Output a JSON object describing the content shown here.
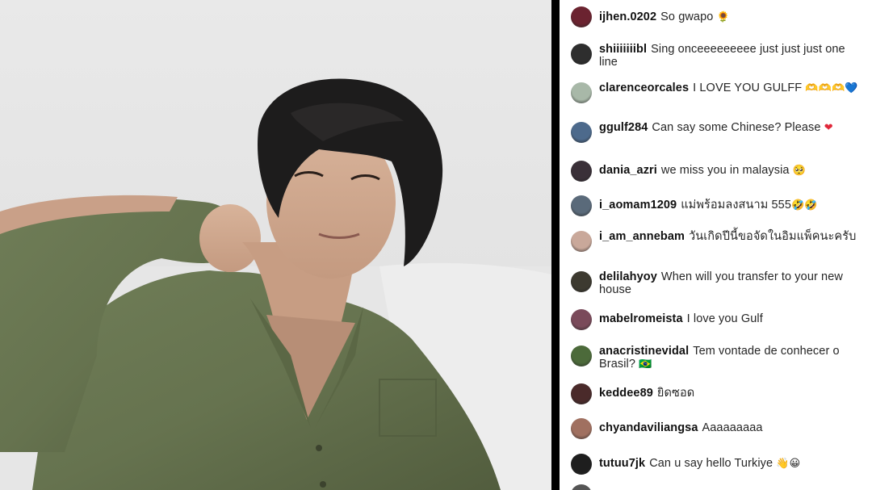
{
  "stream": {
    "video_description_hidden": ""
  },
  "comments": [
    {
      "username": "ijhen.0202",
      "text": "So gwapo",
      "emoji": "🌻",
      "avatar_color": "#6b2330"
    },
    {
      "username": "shiiiiiiibl",
      "text": "Sing onceeeeeeeee just just just one line",
      "emoji": "",
      "avatar_color": "#2e2e2e"
    },
    {
      "username": "clarenceorcales",
      "text": "I LOVE YOU GULFF",
      "emoji": "🫶🫶🫶💙",
      "avatar_color": "#a8b8a8"
    },
    {
      "username": "ggulf284",
      "text": "Can say some Chinese? Please",
      "emoji": "❤",
      "avatar_color": "#4d6a8c"
    },
    {
      "username": "dania_azri",
      "text": "we miss you in malaysia",
      "emoji": "🥺",
      "avatar_color": "#3a3038"
    },
    {
      "username": "i_aomam1209",
      "text": "แม่พร้อมลงสนาม 555",
      "emoji": "🤣🤣",
      "avatar_color": "#5a6a7a"
    },
    {
      "username": "i_am_annebam",
      "text": "วันเกิดปีนี้ขอจัดในอิมแพ็คนะครับ",
      "emoji": "",
      "avatar_color": "#c9a89a"
    },
    {
      "username": "delilahyoy",
      "text": "When will you transfer to your new house",
      "emoji": "",
      "avatar_color": "#3d3a30"
    },
    {
      "username": "mabelromeista",
      "text": "I love you Gulf",
      "emoji": "",
      "avatar_color": "#7a4a5a"
    },
    {
      "username": "anacristinevidal",
      "text": "Tem vontade de conhecer o Brasil?",
      "emoji": "🇧🇷",
      "avatar_color": "#4c6a3a"
    },
    {
      "username": "keddee89",
      "text": "ยิดซอด",
      "emoji": "",
      "avatar_color": "#4a2a2a"
    },
    {
      "username": "chyandaviliangsa",
      "text": "Aaaaaaaaa",
      "emoji": "",
      "avatar_color": "#a07060"
    },
    {
      "username": "tutuu7jk",
      "text": "Can u say hello Turkiye",
      "emoji": "👋😀",
      "avatar_color": "#1e1e1e"
    }
  ]
}
